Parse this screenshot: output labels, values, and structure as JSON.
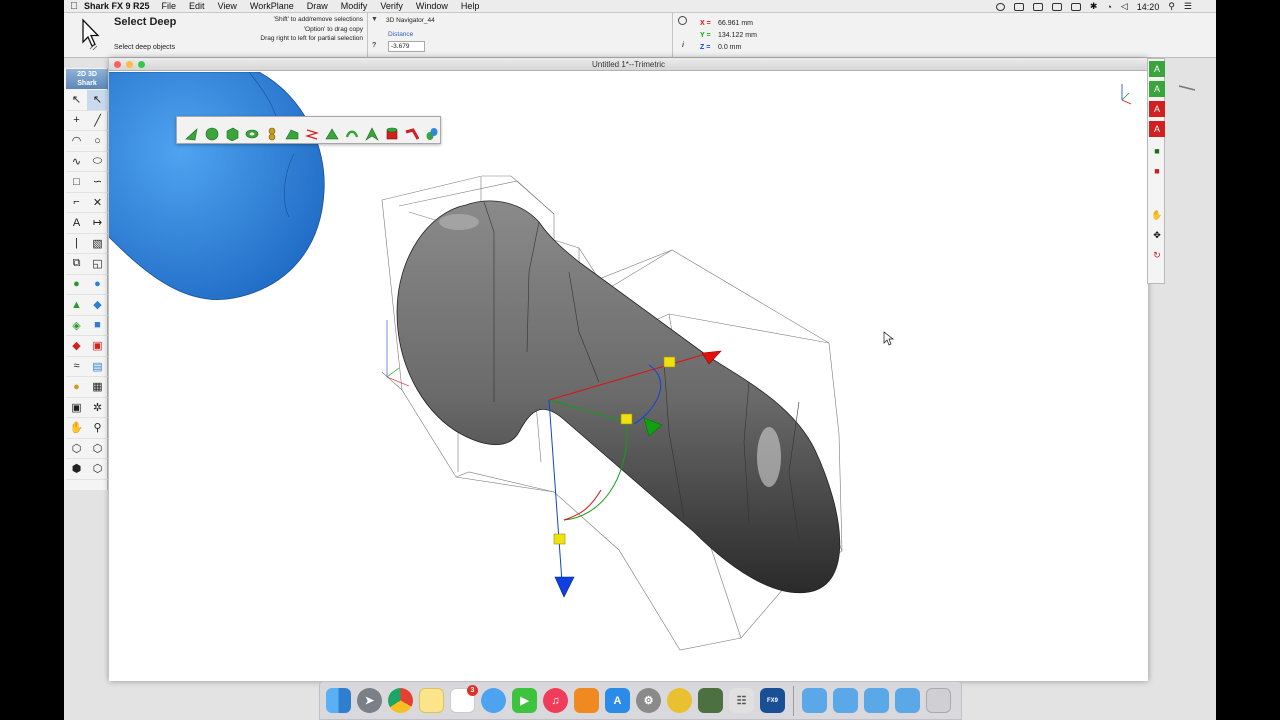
{
  "menubar": {
    "apple": "",
    "app_name": "Shark FX 9 R25",
    "items": [
      "File",
      "Edit",
      "View",
      "WorkPlane",
      "Draw",
      "Modify",
      "Verify",
      "Window",
      "Help"
    ],
    "clock": "14:20"
  },
  "toolinfo": {
    "title": "Select Deep",
    "description": "Select deep objects",
    "hint_1": "'Shift' to add/remove selections",
    "hint_2": "'Option' to drag copy",
    "hint_3": "Drag right to left for partial selection",
    "navigator": "3D Navigator_44",
    "distance_label": "Distance",
    "distance_value": "-3.679",
    "question_glyph": "?",
    "info_glyph": "i",
    "coords": {
      "x_label": "X =",
      "x_value": "66.961 mm",
      "y_label": "Y =",
      "y_value": "134.122 mm",
      "z_label": "Z =",
      "z_value": "0.0 mm"
    }
  },
  "toolbox": {
    "badge_top": "2D  3D",
    "badge_bottom": "Shark"
  },
  "window": {
    "title": "Untitled 1*--Trimetric"
  },
  "colors": {
    "close": "#fc605c",
    "minimize": "#fdbc40",
    "zoom": "#34c84a",
    "solid_blue": "#2f86df",
    "solid_gray": "#6e6e6e",
    "axis_x": "#e01010",
    "axis_y": "#10a010",
    "axis_z": "#1040e0",
    "handle": "#f0e010"
  },
  "dock": {
    "notification_badge": "3",
    "fx_label": "FX9"
  }
}
